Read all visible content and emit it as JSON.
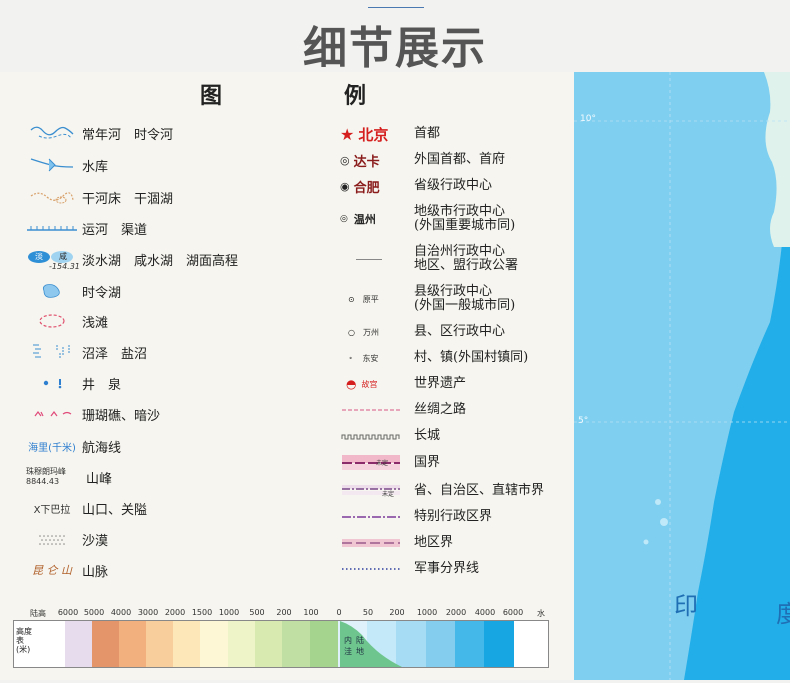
{
  "page": {
    "title": "细节展示"
  },
  "legend": {
    "heading_left": "图",
    "heading_right": "例",
    "left_items": [
      {
        "label": "常年河　时令河",
        "icon": "river-icon"
      },
      {
        "label": "水库",
        "icon": "reservoir-icon"
      },
      {
        "label": "干河床　干涸湖",
        "icon": "dry-riverbed-icon"
      },
      {
        "label": "运河　渠道",
        "icon": "canal-icon"
      },
      {
        "label": "淡水湖　咸水湖　湖面高程",
        "icon": "lake-icon",
        "sample_fresh": "淡",
        "sample_salt": "咸",
        "sample_elev": "-154.31"
      },
      {
        "label": "时令湖",
        "icon": "seasonal-lake-icon"
      },
      {
        "label": "浅滩",
        "icon": "shoal-icon"
      },
      {
        "label": "沼泽　盐沼",
        "icon": "marsh-icon"
      },
      {
        "label": "井　泉",
        "icon": "well-spring-icon"
      },
      {
        "label": "珊瑚礁、暗沙",
        "icon": "coral-reef-icon"
      },
      {
        "label": "航海线",
        "icon": "sea-route-icon",
        "sample": "海里(千米)"
      },
      {
        "label": "山峰",
        "icon": "peak-icon",
        "sample_name": "珠穆朗玛峰",
        "sample_height": "8844.43"
      },
      {
        "label": "山口、关隘",
        "icon": "mountain-pass-icon",
        "sample": "X下巴拉"
      },
      {
        "label": "沙漠",
        "icon": "desert-icon"
      },
      {
        "label": "山脉",
        "icon": "mountain-range-icon",
        "sample": "昆 仑 山"
      }
    ],
    "right_items": [
      {
        "sample": "北京",
        "label": "首都",
        "icon": "capital-star-icon"
      },
      {
        "sample": "达卡",
        "label": "外国首都、首府",
        "icon": "foreign-capital-icon"
      },
      {
        "sample": "合肥",
        "label": "省级行政中心",
        "icon": "provincial-center-icon"
      },
      {
        "sample": "温州",
        "label": "地级市行政中心\n(外国重要城市同)",
        "icon": "prefecture-city-icon"
      },
      {
        "sample": "",
        "label": "自治州行政中心\n地区、盟行政公署",
        "icon": "autonomous-prefecture-icon"
      },
      {
        "sample": "原平",
        "label": "县级行政中心\n(外国一般城市同)",
        "icon": "county-city-icon"
      },
      {
        "sample": "万州",
        "label": "县、区行政中心",
        "icon": "county-district-icon"
      },
      {
        "sample": "东安",
        "label": "村、镇(外国村镇同)",
        "icon": "village-town-icon"
      },
      {
        "sample": "故宫",
        "label": "世界遗产",
        "icon": "world-heritage-icon"
      },
      {
        "sample": "",
        "label": "丝绸之路",
        "icon": "silk-road-icon"
      },
      {
        "sample": "",
        "label": "长城",
        "icon": "great-wall-icon"
      },
      {
        "sample": "",
        "label": "国界",
        "icon": "national-border-icon",
        "sample_tag1": "未定",
        "sample_tag2": ""
      },
      {
        "sample": "",
        "label": "省、自治区、直辖市界",
        "icon": "provincial-border-icon",
        "sample_tag": "未定"
      },
      {
        "sample": "",
        "label": "特别行政区界",
        "icon": "sar-border-icon"
      },
      {
        "sample": "",
        "label": "地区界",
        "icon": "district-border-icon"
      },
      {
        "sample": "",
        "label": "军事分界线",
        "icon": "military-line-icon"
      }
    ]
  },
  "elevation_scale": {
    "left_title": "陆高",
    "right_title": "水深",
    "ticks": [
      "6000",
      "5000",
      "4000",
      "3000",
      "2000",
      "1500",
      "1000",
      "500",
      "200",
      "100",
      "0",
      "50",
      "200",
      "1000",
      "2000",
      "4000",
      "6000"
    ],
    "axis_label": "高度表(米)",
    "depression_label": "内陆洼地",
    "colors": [
      "#ffffff",
      "#e6dced",
      "#e5956a",
      "#f2b07f",
      "#f8cf9c",
      "#fde6b8",
      "#fdf7d6",
      "#eef3c8",
      "#d9eab0",
      "#bfe0a2",
      "#a5d48e",
      "#dff2fb",
      "#c4e9f8",
      "#a6dcf4",
      "#84cdef",
      "#45b8ea",
      "#18a6e3"
    ]
  },
  "map": {
    "lat_10": "10°",
    "lat_5": "5°",
    "label_india": "印",
    "label_partial": "度"
  }
}
